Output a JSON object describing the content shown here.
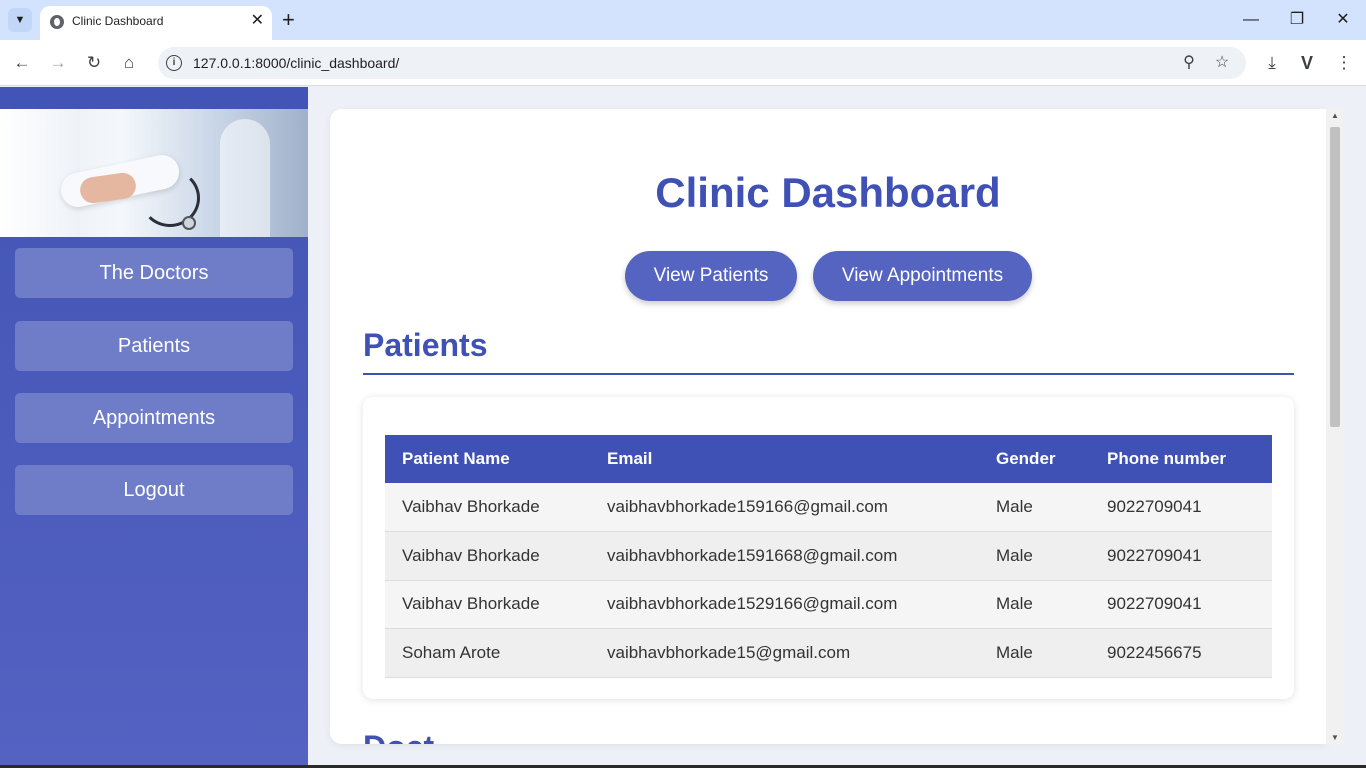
{
  "browser": {
    "tab_title": "Clinic Dashboard",
    "tab_close": "✕",
    "new_tab": "+",
    "url": "127.0.0.1:8000/clinic_dashboard/",
    "icons": [
      "tab-search-icon",
      "back-icon",
      "forward-icon",
      "reload-icon",
      "home-icon",
      "site-info-icon",
      "zoom-icon",
      "bookmark-star-icon",
      "download-icon",
      "extension-v-icon",
      "menu-icon",
      "minimize-icon",
      "restore-icon",
      "close-icon"
    ],
    "extension_label": "V"
  },
  "sidebar": {
    "items": [
      {
        "label": "The Doctors"
      },
      {
        "label": "Patients"
      },
      {
        "label": "Appointments"
      },
      {
        "label": "Logout"
      }
    ]
  },
  "main": {
    "title": "Clinic Dashboard",
    "buttons": {
      "view_patients": "View Patients",
      "view_appointments": "View Appointments"
    },
    "patients_section": {
      "title": "Patients",
      "columns": [
        "Patient Name",
        "Email",
        "Gender",
        "Phone number"
      ],
      "rows": [
        [
          "Vaibhav Bhorkade",
          "vaibhavbhorkade159166@gmail.com",
          "Male",
          "9022709041"
        ],
        [
          "Vaibhav Bhorkade",
          "vaibhavbhorkade1591668@gmail.com",
          "Male",
          "9022709041"
        ],
        [
          "Vaibhav Bhorkade",
          "vaibhavbhorkade1529166@gmail.com",
          "Male",
          "9022709041"
        ],
        [
          "Soham Arote",
          "vaibhavbhorkade15@gmail.com",
          "Male",
          "9022456675"
        ]
      ]
    },
    "next_section_partial": "Doct"
  },
  "colors": {
    "accent": "#3f51b5",
    "sidebar_bg": "#4a5ab8",
    "nav_button": "#6f7dc8",
    "pill_button": "#5563c1"
  }
}
